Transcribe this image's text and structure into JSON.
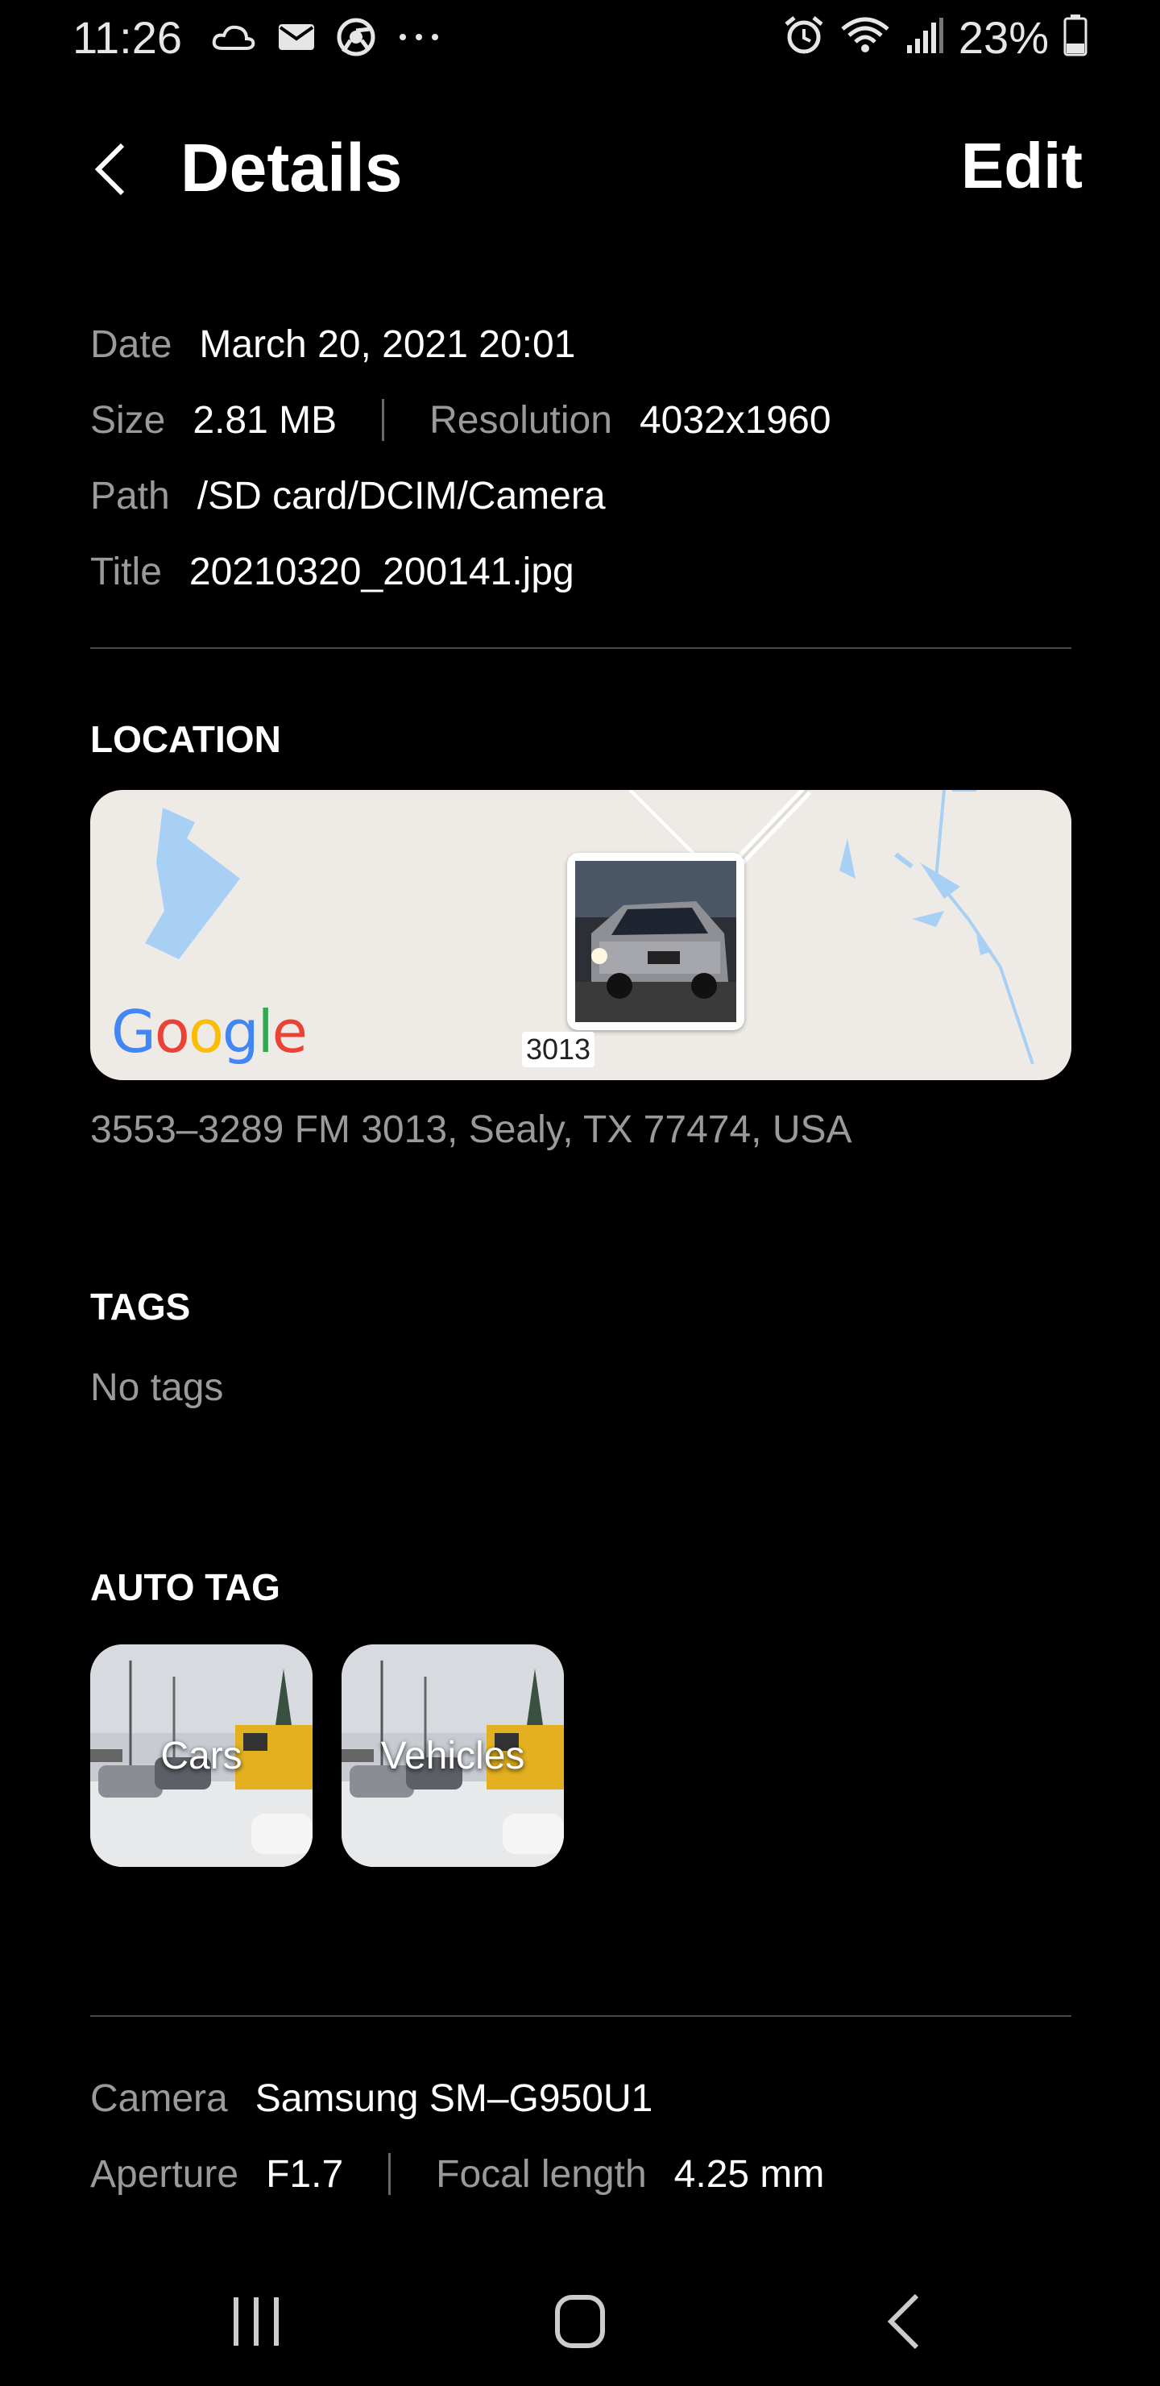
{
  "status_bar": {
    "time": "11:26",
    "battery": "23%",
    "left_icons": [
      "cloud-icon",
      "mail-icon",
      "chrome-icon",
      "more-notifications-icon"
    ],
    "right_icons": [
      "alarm-icon",
      "wifi-icon",
      "signal-icon",
      "battery-icon"
    ]
  },
  "header": {
    "title": "Details",
    "edit_label": "Edit"
  },
  "info": {
    "date_label": "Date",
    "date_value": "March 20, 2021 20:01",
    "size_label": "Size",
    "size_value": "2.81 MB",
    "resolution_label": "Resolution",
    "resolution_value": "4032x1960",
    "path_label": "Path",
    "path_value": "/SD card/DCIM/Camera",
    "title_label": "Title",
    "title_value": "20210320_200141.jpg"
  },
  "location": {
    "section_title": "LOCATION",
    "road_label": "3013",
    "map_logo": "Google",
    "address": "3553–3289 FM 3013, Sealy, TX 77474, USA"
  },
  "tags": {
    "section_title": "TAGS",
    "empty_text": "No tags"
  },
  "auto_tag": {
    "section_title": "AUTO TAG",
    "items": [
      {
        "label": "Cars"
      },
      {
        "label": "Vehicles"
      }
    ]
  },
  "camera": {
    "camera_label": "Camera",
    "camera_value": "Samsung SM–G950U1",
    "aperture_label": "Aperture",
    "aperture_value": "F1.7",
    "focal_label": "Focal length",
    "focal_value": "4.25 mm"
  },
  "colors": {
    "background": "#000000",
    "label": "#9a9a9a",
    "text": "#ffffff",
    "map_bg": "#eeebe6",
    "water": "#a8d0f5"
  }
}
